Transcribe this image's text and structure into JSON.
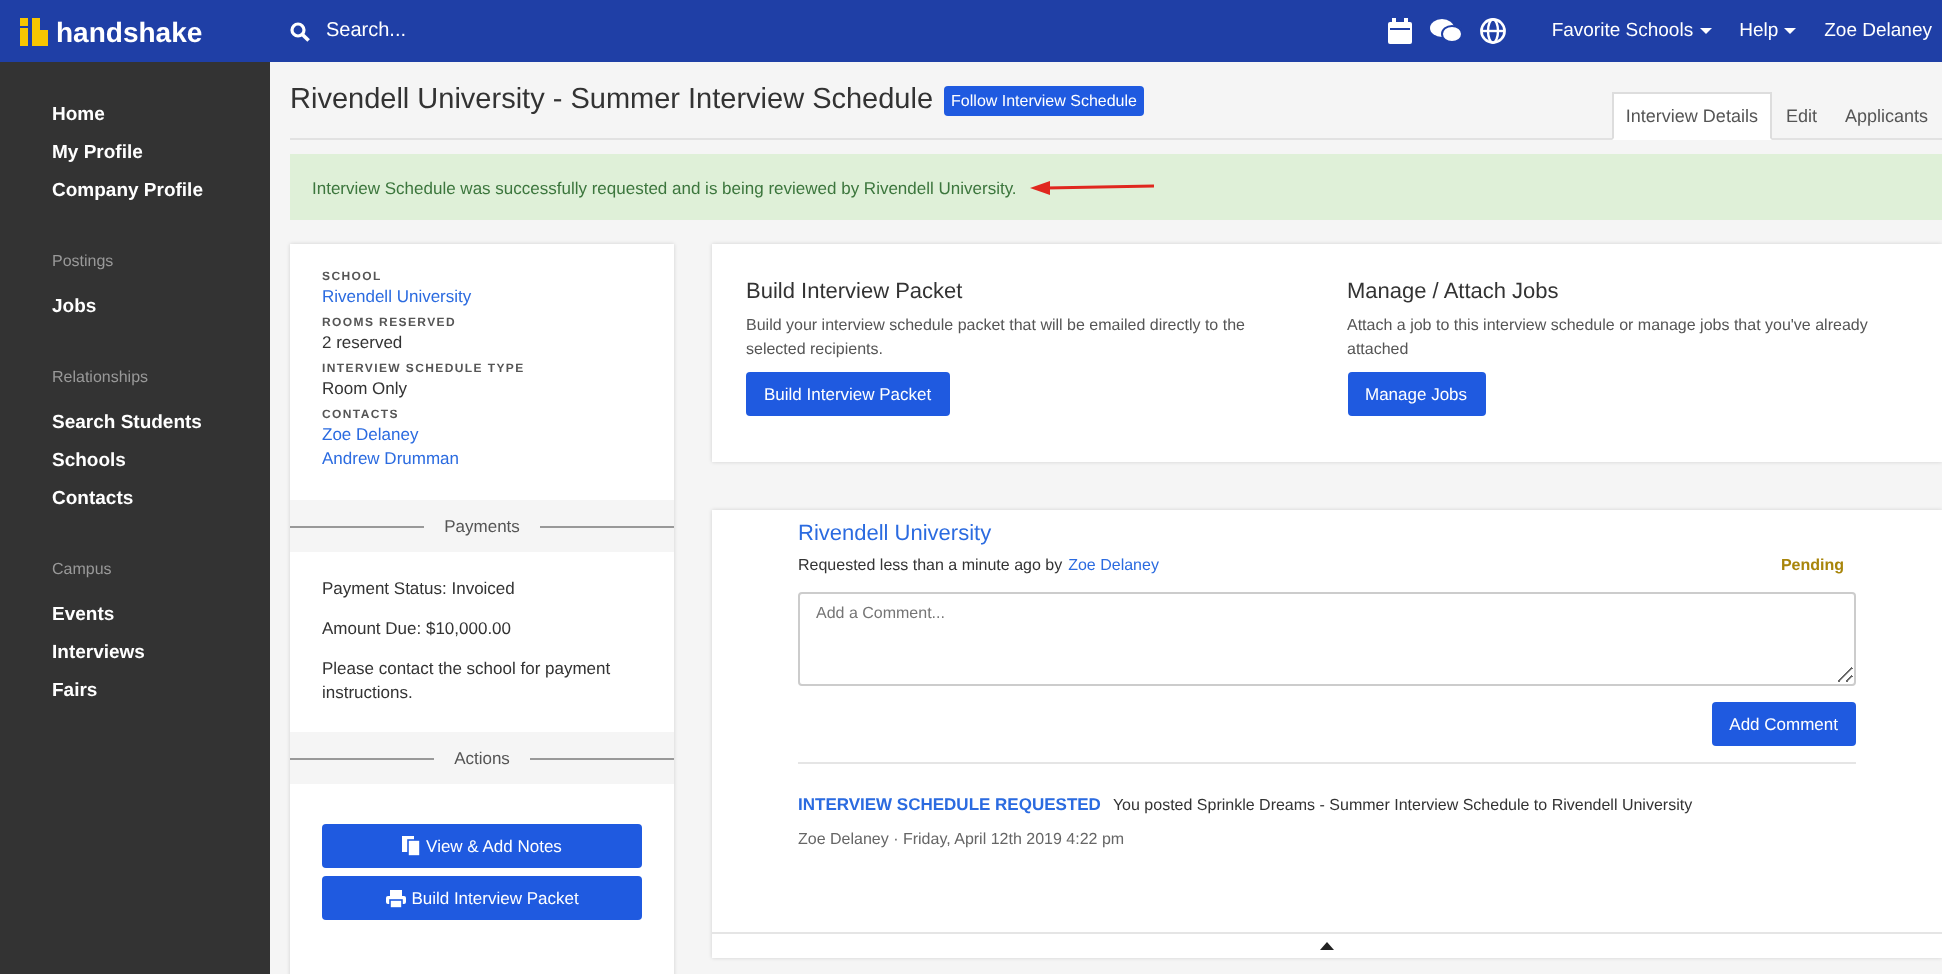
{
  "topbar": {
    "logo": "handshake",
    "search": {
      "placeholder": "Search..."
    },
    "menus": [
      {
        "label": "Favorite Schools",
        "dropdown": true
      },
      {
        "label": "Help",
        "dropdown": true
      },
      {
        "label": "Zoe Delaney",
        "dropdown": false
      }
    ]
  },
  "sidebar": {
    "sections": [
      {
        "items": [
          "Home",
          "My Profile",
          "Company Profile"
        ]
      },
      {
        "heading": "Postings",
        "items": [
          "Jobs"
        ]
      },
      {
        "heading": "Relationships",
        "items": [
          "Search Students",
          "Schools",
          "Contacts"
        ]
      },
      {
        "heading": "Campus",
        "items": [
          "Events",
          "Interviews",
          "Fairs"
        ]
      }
    ]
  },
  "page": {
    "title": "Rivendell University - Summer Interview Schedule",
    "follow_button": "Follow Interview Schedule",
    "tabs": [
      {
        "label": "Interview Details",
        "selected": true
      },
      {
        "label": "Edit",
        "selected": false
      },
      {
        "label": "Applicants",
        "selected": false
      }
    ],
    "alert": "Interview Schedule was successfully requested and is being reviewed by Rivendell University."
  },
  "details": {
    "fields": [
      {
        "label": "SCHOOL",
        "values": [
          {
            "text": "Rivendell University",
            "link": true
          }
        ]
      },
      {
        "label": "ROOMS RESERVED",
        "values": [
          {
            "text": "2 reserved",
            "link": false
          }
        ]
      },
      {
        "label": "INTERVIEW SCHEDULE TYPE",
        "values": [
          {
            "text": "Room Only",
            "link": false
          }
        ]
      },
      {
        "label": "CONTACTS",
        "values": [
          {
            "text": "Zoe Delaney",
            "link": true
          },
          {
            "text": "Andrew Drumman",
            "link": true
          }
        ]
      }
    ],
    "payments": {
      "heading": "Payments",
      "lines": [
        "Payment Status: Invoiced",
        "Amount Due: $10,000.00",
        "Please contact the school for payment instructions."
      ]
    },
    "actions": {
      "heading": "Actions",
      "buttons": [
        {
          "label": "View & Add Notes",
          "kind": "notes"
        },
        {
          "label": "Build Interview Packet",
          "kind": "print"
        }
      ]
    }
  },
  "tools": [
    {
      "title": "Build Interview Packet",
      "description": "Build your interview schedule packet that will be emailed directly to the selected recipients.",
      "button": "Build Interview Packet"
    },
    {
      "title": "Manage / Attach Jobs",
      "description": "Attach a job to this interview schedule or manage jobs that you've already attached",
      "button": "Manage Jobs"
    }
  ],
  "request": {
    "school": "Rivendell University",
    "requested_text": "Requested less than a minute ago by",
    "requester": "Zoe Delaney",
    "status": "Pending",
    "comment": {
      "placeholder": "Add a Comment..."
    },
    "add_button": "Add Comment",
    "activity": [
      {
        "tag": "INTERVIEW SCHEDULE REQUESTED",
        "text": "You posted Sprinkle Dreams - Summer Interview Schedule to Rivendell University",
        "meta": "Zoe Delaney · Friday, April 12th 2019 4:22 pm"
      }
    ]
  }
}
